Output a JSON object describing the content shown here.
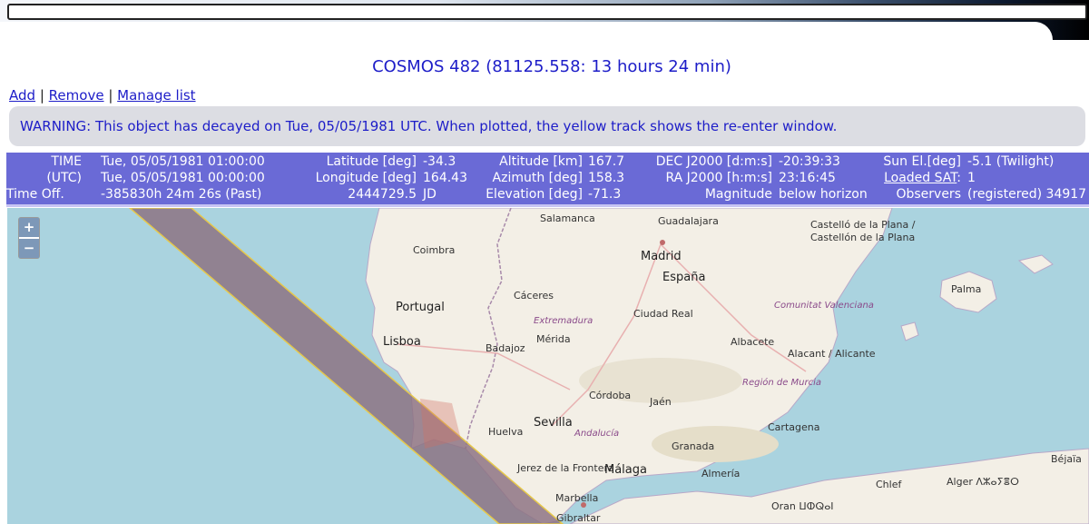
{
  "title": "COSMOS 482 (81125.558: 13 hours 24 min)",
  "links": {
    "add": "Add",
    "sep1": "|",
    "remove": "Remove",
    "sep2": "|",
    "manage": "Manage list"
  },
  "warning": "WARNING: This object has decayed on Tue, 05/05/1981 UTC. When plotted, the yellow track shows the re-enter window.",
  "info": {
    "time_label": "TIME",
    "time_value": "Tue, 05/05/1981 01:00:00",
    "utc_label": "(UTC)",
    "utc_value": "Tue, 05/05/1981 00:00:00",
    "offset_label": "Time Off.",
    "offset_value": "-385830h 24m 26s (Past)",
    "lat_label": "Latitude [deg]",
    "lat_value": "-34.3",
    "lon_label": "Longitude [deg]",
    "lon_value": "164.43",
    "jd_value": "2444729.5",
    "jd_label": "JD",
    "alt_label": "Altitude [km]",
    "alt_value": "167.7",
    "az_label": "Azimuth [deg]",
    "az_value": "158.3",
    "el_label": "Elevation [deg]",
    "el_value": "-71.3",
    "dec_label": "DEC J2000 [d:m:s]",
    "dec_value": "-20:39:33",
    "ra_label": "RA J2000 [h:m:s]",
    "ra_value": "23:16:45",
    "mag_label": "Magnitude",
    "mag_value": "below horizon",
    "sun_label": "Sun El.[deg]",
    "sun_value": "-5.1 (Twilight)",
    "loaded_label": "Loaded SAT",
    "loaded_colon": ":",
    "loaded_value": "1",
    "obs_label": "Observers",
    "obs_value": "(registered) 34917"
  },
  "map": {
    "zoom_in": "+",
    "zoom_out": "−",
    "cities": [
      "Salamanca",
      "Guadalajara",
      "Madrid",
      "Coimbra",
      "Cáceres",
      "Ciudad Real",
      "Lisboa",
      "Badajoz",
      "Mérida",
      "Albacete",
      "Alacant / Alicante",
      "Córdoba",
      "Jaén",
      "Sevilla",
      "Huelva",
      "Granada",
      "Cartagena",
      "Jerez de la Frontera",
      "Málaga",
      "Almería",
      "Marbella",
      "Gibraltar",
      "Palma",
      "Castelló de la Plana / Castellón de la Plana",
      "Oran ⵡⵀⵕⴰⵏ",
      "Alger ⴷⵣⴰⵢⴻⵔ",
      "Béjaïa",
      "Chlef"
    ],
    "countries": [
      "Portugal",
      "España"
    ],
    "regions": [
      "Extremadura",
      "Andalucía",
      "Región de Murcia",
      "Comunitat Valenciana"
    ],
    "track_color": "#8b7080",
    "reentry_color": "#e6c84a"
  }
}
